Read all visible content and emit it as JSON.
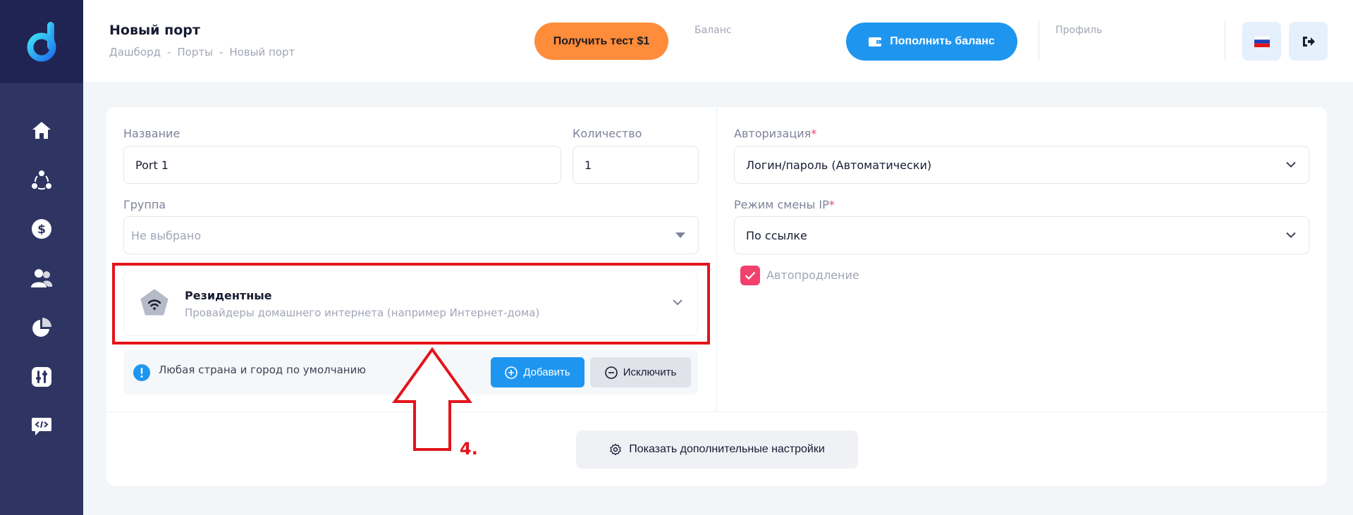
{
  "colors": {
    "sidebar": "#2f3563",
    "accent_blue": "#1e96f0",
    "accent_orange": "#ff8c3b",
    "checkbox": "#f1416c",
    "annotation_red": "#e3141b"
  },
  "sidebar": {
    "logo": "d-logo",
    "items": [
      {
        "icon": "home-icon"
      },
      {
        "icon": "share-nodes-icon"
      },
      {
        "icon": "dollar-icon"
      },
      {
        "icon": "users-icon"
      },
      {
        "icon": "pie-chart-icon"
      },
      {
        "icon": "sliders-icon"
      },
      {
        "icon": "code-message-icon"
      }
    ]
  },
  "header": {
    "title": "Новый порт",
    "breadcrumb": [
      "Дашборд",
      "Порты",
      "Новый порт"
    ],
    "breadcrumb_sep": "-",
    "test_button": "Получить тест $1",
    "balance_label": "Баланс",
    "topup_button": "Пополнить баланс",
    "profile_label": "Профиль",
    "language_icon": "russia-flag-icon",
    "logout_icon": "logout-icon"
  },
  "form": {
    "name_label": "Название",
    "name_value": "Port 1",
    "quantity_label": "Количество",
    "quantity_value": "1",
    "group_label": "Группа",
    "group_placeholder": "Не выбрано",
    "proxy_type": {
      "title": "Резидентные",
      "subtitle": "Провайдеры домашнего интернета (например Интернет-дома)",
      "icon": "wifi-icon"
    },
    "location_info": "Любая страна и город по умолчанию",
    "add_button": "Добавить",
    "exclude_button": "Исключить",
    "auth_label": "Авторизация",
    "auth_required": "*",
    "auth_value": "Логин/пароль (Автоматически)",
    "ip_mode_label": "Режим смены IP",
    "ip_mode_required": "*",
    "ip_mode_value": "По ссылке",
    "autorenew_label": "Автопродление",
    "autorenew_checked": true,
    "more_settings_button": "Показать дополнительные настройки"
  },
  "annotation": {
    "step": "4."
  }
}
